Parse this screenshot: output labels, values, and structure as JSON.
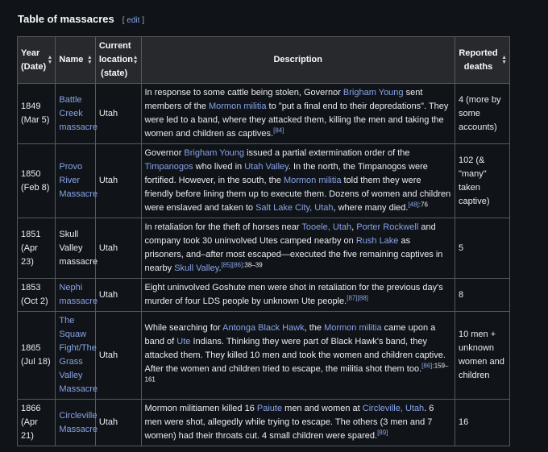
{
  "heading": {
    "title": "Table of massacres",
    "edit_open": "[",
    "edit_label": "edit",
    "edit_close": "]"
  },
  "columns": [
    {
      "line1": "Year",
      "line2": "(Date)"
    },
    {
      "line1": "Name"
    },
    {
      "line1": "Current",
      "line2": "location",
      "line3": "(state)"
    },
    {
      "line1": "Description"
    },
    {
      "line1": "Reported",
      "line2": "deaths"
    }
  ],
  "rows": [
    {
      "year": "1849",
      "date": "(Mar 5)",
      "name": "Battle Creek massacre",
      "name_linked": true,
      "location": "Utah",
      "desc": [
        {
          "t": "In response to some cattle being stolen, Governor "
        },
        {
          "l": "Brigham Young"
        },
        {
          "t": " sent members of the "
        },
        {
          "l": "Mormon militia"
        },
        {
          "t": " to \"put a final end to their depredations\". They were led to a band, where they attacked them, killing the men and taking the women and children as captives."
        },
        {
          "r": "[84]"
        }
      ],
      "deaths": "4 (more by some accounts)"
    },
    {
      "year": "1850",
      "date": "(Feb 8)",
      "name": "Provo River Massacre",
      "name_linked": true,
      "location": "Utah",
      "desc": [
        {
          "t": "Governor "
        },
        {
          "l": "Brigham Young"
        },
        {
          "t": " issued a partial extermination order of the "
        },
        {
          "l": "Timpanogos"
        },
        {
          "t": " who lived in "
        },
        {
          "l": "Utah Valley"
        },
        {
          "t": ". In the north, the Timpanogos were fortified. However, in the south, the "
        },
        {
          "l": "Mormon militia"
        },
        {
          "t": " told them they were friendly before lining them up to execute them. Dozens of women and children were enslaved and taken to "
        },
        {
          "l": "Salt Lake City, Utah"
        },
        {
          "t": ", where many died."
        },
        {
          "r": "[48]"
        },
        {
          "p": ":76"
        }
      ],
      "deaths": "102 (& \"many\" taken captive)"
    },
    {
      "year": "1851",
      "date": "(Apr 23)",
      "name": "Skull Valley massacre",
      "name_linked": false,
      "location": "Utah",
      "desc": [
        {
          "t": "In retaliation for the theft of horses near "
        },
        {
          "l": "Tooele, Utah"
        },
        {
          "t": ", "
        },
        {
          "l": "Porter Rockwell"
        },
        {
          "t": " and company took 30 uninvolved Utes camped nearby on "
        },
        {
          "l": "Rush Lake"
        },
        {
          "t": " as prisoners, and–after most escaped—executed the five remaining captives in nearby "
        },
        {
          "l": "Skull Valley"
        },
        {
          "t": "."
        },
        {
          "r": "[85]"
        },
        {
          "r": "[86]"
        },
        {
          "p": ":38–39"
        }
      ],
      "deaths": "5"
    },
    {
      "year": "1853",
      "date": "(Oct 2)",
      "name": "Nephi massacre",
      "name_linked": true,
      "location": "Utah",
      "desc": [
        {
          "t": "Eight uninvolved Goshute men were shot in retaliation for the previous day's murder of four LDS people by unknown Ute people."
        },
        {
          "r": "[87]"
        },
        {
          "r": "[88]"
        }
      ],
      "deaths": "8"
    },
    {
      "year": "1865",
      "date": "(Jul 18)",
      "name": "The Squaw Fight/The Grass Valley Massacre",
      "name_linked": true,
      "location": "Utah",
      "desc": [
        {
          "t": "While searching for "
        },
        {
          "l": "Antonga Black Hawk"
        },
        {
          "t": ", the "
        },
        {
          "l": "Mormon militia"
        },
        {
          "t": " came upon a band of "
        },
        {
          "l": "Ute"
        },
        {
          "t": " Indians. Thinking they were part of Black Hawk's band, they attacked them. They killed 10 men and took the women and children captive. After the women and children tried to escape, the militia shot them too."
        },
        {
          "r": "[86]"
        },
        {
          "p": ":159–161"
        }
      ],
      "deaths": "10 men + unknown women and children"
    },
    {
      "year": "1866",
      "date": "(Apr 21)",
      "name": "Circleville Massacre",
      "name_linked": true,
      "location": "Utah",
      "desc": [
        {
          "t": "Mormon militiamen killed 16 "
        },
        {
          "l": "Paiute"
        },
        {
          "t": " men and women at "
        },
        {
          "l": "Circleville, Utah"
        },
        {
          "t": ". 6 men were shot, allegedly while trying to escape. The others (3 men and 7 women) had their throats cut. 4 small children were spared."
        },
        {
          "r": "[89]"
        }
      ],
      "deaths": "16"
    }
  ],
  "sort_icon": "sort-arrows-icon",
  "colors": {
    "background": "#101418",
    "header_bg": "#27292d",
    "border": "#54595d",
    "link": "#88a3e8",
    "text": "#eaecf0"
  }
}
